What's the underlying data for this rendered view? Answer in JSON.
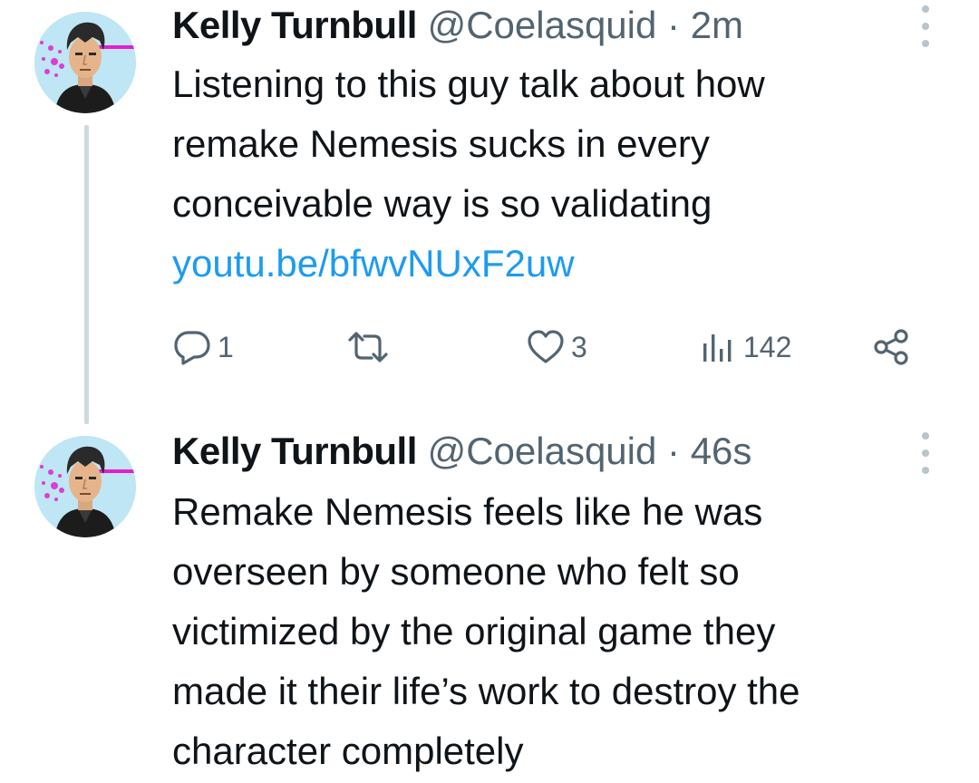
{
  "tweets": [
    {
      "author_name": "Kelly Turnbull",
      "handle": "@Coelasquid",
      "separator": "·",
      "time": "2m",
      "text_lines": [
        "Listening to this guy talk about how",
        "remake Nemesis sucks in every",
        "conceivable way is so validating"
      ],
      "link": "youtu.be/bfwvNUxF2uw",
      "actions": {
        "reply_count": "1",
        "retweet_count": "",
        "like_count": "3",
        "views_count": "142"
      }
    },
    {
      "author_name": "Kelly Turnbull",
      "handle": "@Coelasquid",
      "separator": "·",
      "time": "46s",
      "text_lines": [
        "Remake Nemesis feels like he was",
        "overseen by someone who felt so",
        "victimized by the original game they",
        "made it their life’s work to destroy the",
        "character completely"
      ]
    }
  ],
  "icons": {
    "avatar": "avatar-illustration",
    "more": "more-vertical-icon",
    "reply": "reply-icon",
    "retweet": "retweet-icon",
    "like": "heart-icon",
    "views": "views-bar-chart-icon",
    "share": "share-icon"
  },
  "colors": {
    "text": "#0f1419",
    "secondary": "#536471",
    "link": "#1d9bf0",
    "thread_line": "#cfd9de",
    "avatar_bg": "#bfe6f4",
    "avatar_accent": "#e21fd0"
  }
}
